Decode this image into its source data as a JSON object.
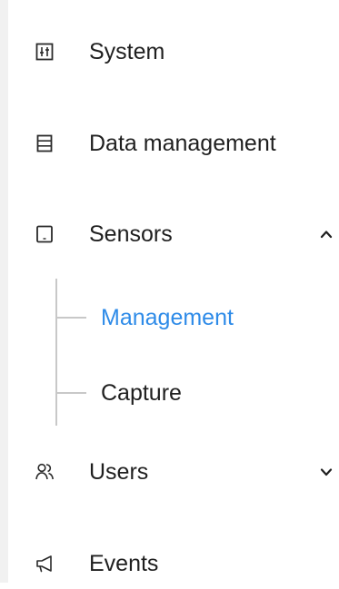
{
  "nav": {
    "items": [
      {
        "label": "System",
        "icon": "system-settings-icon"
      },
      {
        "label": "Data management",
        "icon": "database-icon"
      },
      {
        "label": "Sensors",
        "icon": "sensor-icon",
        "expanded": true
      },
      {
        "label": "Users",
        "icon": "users-icon",
        "expanded": false
      },
      {
        "label": "Events",
        "icon": "megaphone-icon"
      }
    ],
    "sensors_sub": [
      {
        "label": "Management",
        "active": true
      },
      {
        "label": "Capture",
        "active": false
      }
    ]
  },
  "colors": {
    "text": "#1f1f1f",
    "active": "#2e8be8",
    "tree_line": "#c8c8c8",
    "left_strip": "#f1f1f1"
  }
}
